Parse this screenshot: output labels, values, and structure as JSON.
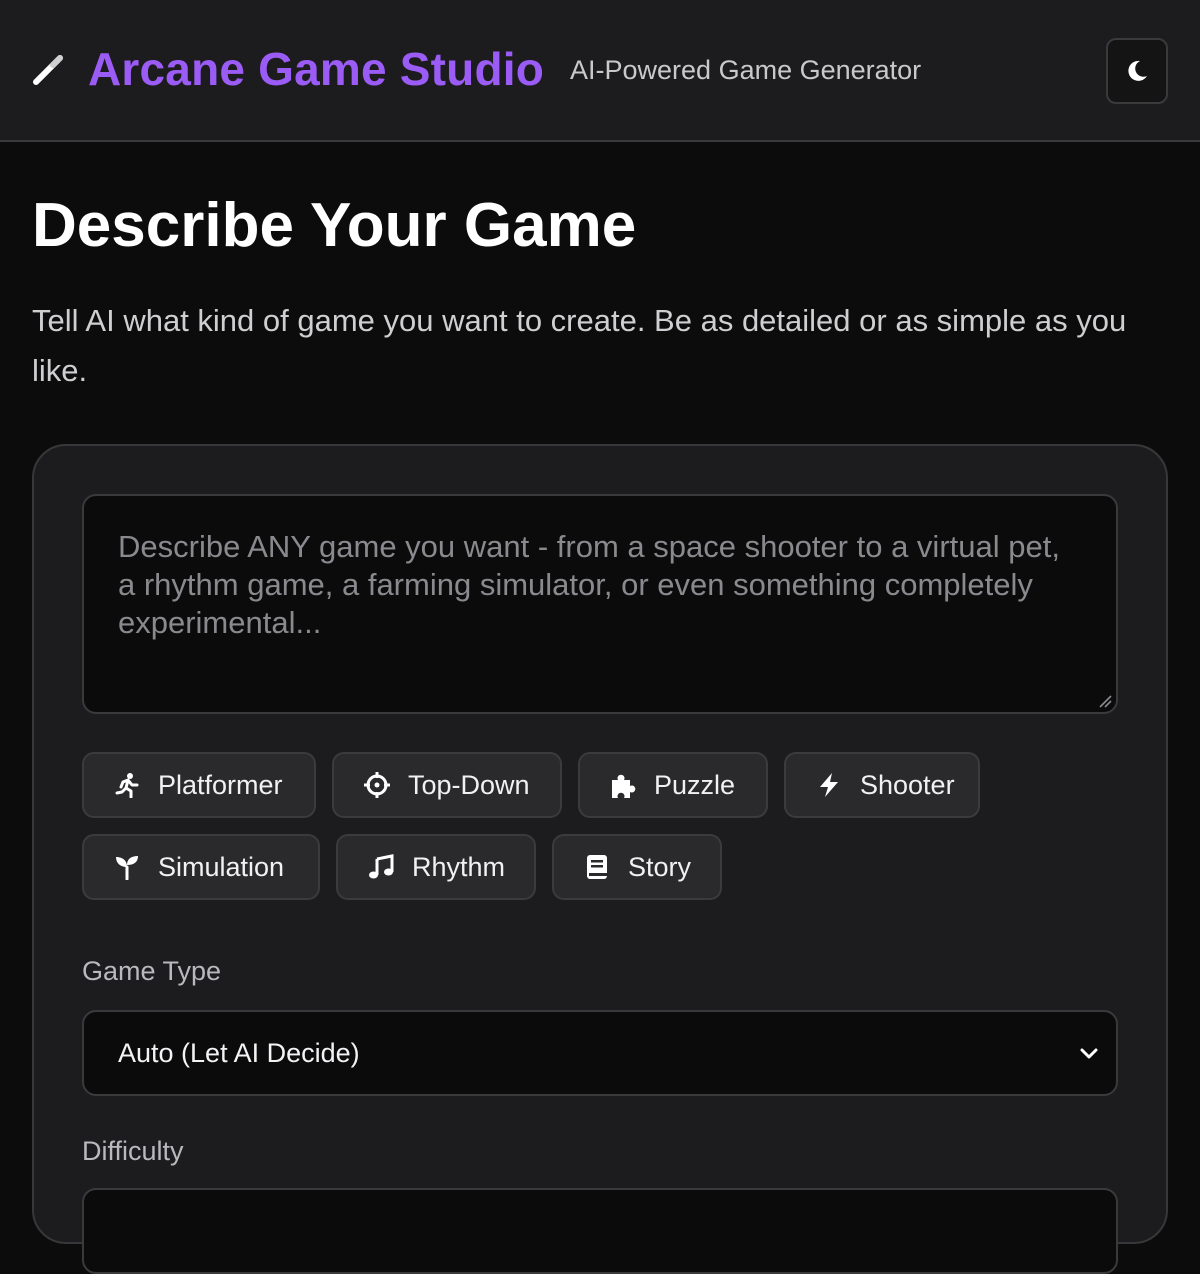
{
  "header": {
    "logo_icon": "magic-wand-icon",
    "title": "Arcane Game Studio",
    "subtitle": "AI-Powered Game Generator",
    "theme_toggle_icon": "moon-icon"
  },
  "intro": {
    "title": "Describe Your Game",
    "description": "Tell AI what kind of game you want to create. Be as detailed or as simple as you like."
  },
  "prompt": {
    "placeholder": "Describe ANY game you want - from a space shooter to a virtual pet, a rhythm game, a farming simulator, or even something completely experimental...",
    "value": ""
  },
  "genres": [
    {
      "label": "Platformer",
      "icon": "running-person-icon"
    },
    {
      "label": "Top-Down",
      "icon": "crosshair-icon"
    },
    {
      "label": "Puzzle",
      "icon": "puzzle-piece-icon"
    },
    {
      "label": "Shooter",
      "icon": "lightning-bolt-icon"
    },
    {
      "label": "Simulation",
      "icon": "seedling-icon"
    },
    {
      "label": "Rhythm",
      "icon": "music-note-icon"
    },
    {
      "label": "Story",
      "icon": "book-icon"
    }
  ],
  "game_type": {
    "label": "Game Type",
    "selected": "Auto (Let AI Decide)"
  },
  "difficulty": {
    "label": "Difficulty"
  },
  "colors": {
    "accent": "#9b5cf6",
    "background": "#0c0c0d",
    "surface": "#1c1c1e",
    "chip": "#2a2a2c"
  }
}
